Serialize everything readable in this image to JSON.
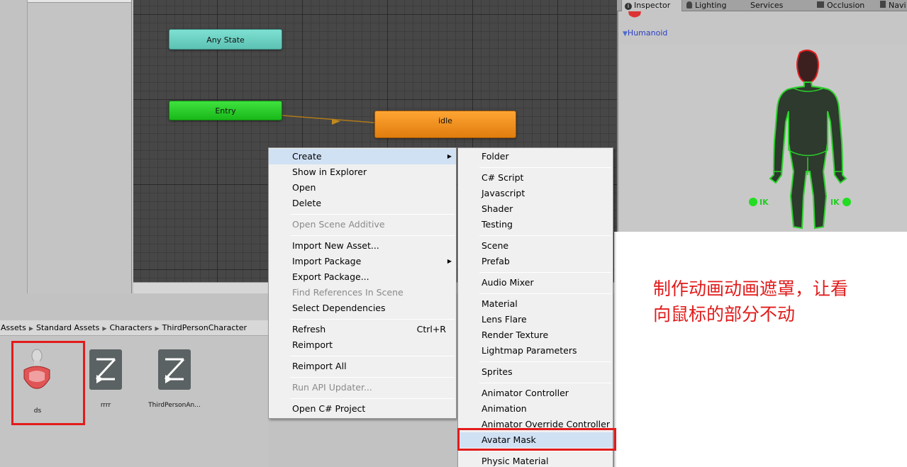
{
  "graph": {
    "nodes": {
      "any_state": "Any State",
      "entry": "Entry",
      "idle": "idle"
    }
  },
  "breadcrumb": [
    "Assets",
    "Standard Assets",
    "Characters",
    "ThirdPersonCharacter"
  ],
  "assets": [
    {
      "label": "ds",
      "icon": "avatar-mask-icon",
      "highlighted": true
    },
    {
      "label": "rrrr",
      "icon": "animator-controller-icon"
    },
    {
      "label": "ThirdPersonAn...",
      "icon": "animator-controller-icon"
    }
  ],
  "context_menu": {
    "create": "Create",
    "show_in_explorer": "Show in Explorer",
    "open": "Open",
    "delete": "Delete",
    "open_scene_additive": "Open Scene Additive",
    "import_new_asset": "Import New Asset...",
    "import_package": "Import Package",
    "export_package": "Export Package...",
    "find_references": "Find References In Scene",
    "select_dependencies": "Select Dependencies",
    "refresh": "Refresh",
    "refresh_shortcut": "Ctrl+R",
    "reimport": "Reimport",
    "reimport_all": "Reimport All",
    "run_api_updater": "Run API Updater...",
    "open_csharp_project": "Open C# Project"
  },
  "create_menu": {
    "folder": "Folder",
    "csharp_script": "C# Script",
    "javascript": "Javascript",
    "shader": "Shader",
    "testing": "Testing",
    "scene": "Scene",
    "prefab": "Prefab",
    "audio_mixer": "Audio Mixer",
    "material": "Material",
    "lens_flare": "Lens Flare",
    "render_texture": "Render Texture",
    "lightmap_parameters": "Lightmap Parameters",
    "sprites": "Sprites",
    "animator_controller": "Animator Controller",
    "animation": "Animation",
    "animator_override_controller": "Animator Override Controller",
    "avatar_mask": "Avatar Mask",
    "physic_material": "Physic Material"
  },
  "tabs": {
    "inspector": "Inspector",
    "lighting": "Lighting",
    "services": "Services",
    "occlusion": "Occlusion",
    "navigation": "Navi"
  },
  "inspector": {
    "humanoid": "Humanoid",
    "ik_left": "IK",
    "ik_right": "IK"
  },
  "annotation": {
    "line1": "制作动画动画遮罩，让看",
    "line2": "向鼠标的部分不动"
  },
  "colors": {
    "annotation_red": "#e11b1b",
    "any_state": "#6cd3c4",
    "entry": "#22c922",
    "idle": "#f28f1c",
    "body_outline": "#2ad12a",
    "body_fill": "#2d3a2d"
  }
}
